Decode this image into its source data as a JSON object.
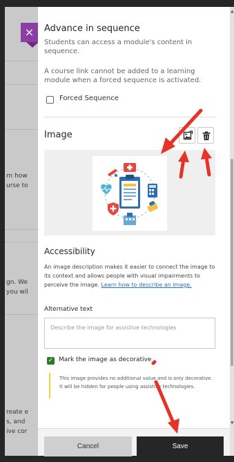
{
  "background_page": {
    "fragments": [
      "rn how",
      "urse to",
      "gn. We",
      "you wil",
      "reate e",
      "s, and",
      "ive cor"
    ]
  },
  "panel": {
    "close_label": "×",
    "advance": {
      "title": "Advance in sequence",
      "description": "Students can access a module's content in sequence.",
      "warning": "A course link cannot be added to a learning module when a forced sequence is activated.",
      "forced_sequence_label": "Forced Sequence",
      "forced_sequence_checked": false
    },
    "image": {
      "title": "Image",
      "replace_icon": "image-replace-icon",
      "delete_icon": "trash-icon",
      "illustration": "medical-clipboard-illustration"
    },
    "accessibility": {
      "title": "Accessibility",
      "description": "An image description makes it easier to connect the image to its context and allows people with visual impairments to perceive the image.",
      "link": "Learn how to describe an image.",
      "alt_label": "Alternative text",
      "alt_placeholder": "Describe the image for assistive technologies",
      "alt_value": "",
      "decorative_label": "Mark the image as decorative",
      "decorative_checked": true,
      "decorative_note": "This image provides no additional value and is only decorative. It will be hidden for people using assistive technologies."
    },
    "footer": {
      "cancel_label": "Cancel",
      "save_label": "Save"
    }
  },
  "colors": {
    "accent_purple": "#8c3fa3",
    "arrow_red": "#e5332a",
    "check_green": "#2a7a2a",
    "note_yellow": "#f2d43f",
    "link_blue": "#2a6dbf"
  }
}
